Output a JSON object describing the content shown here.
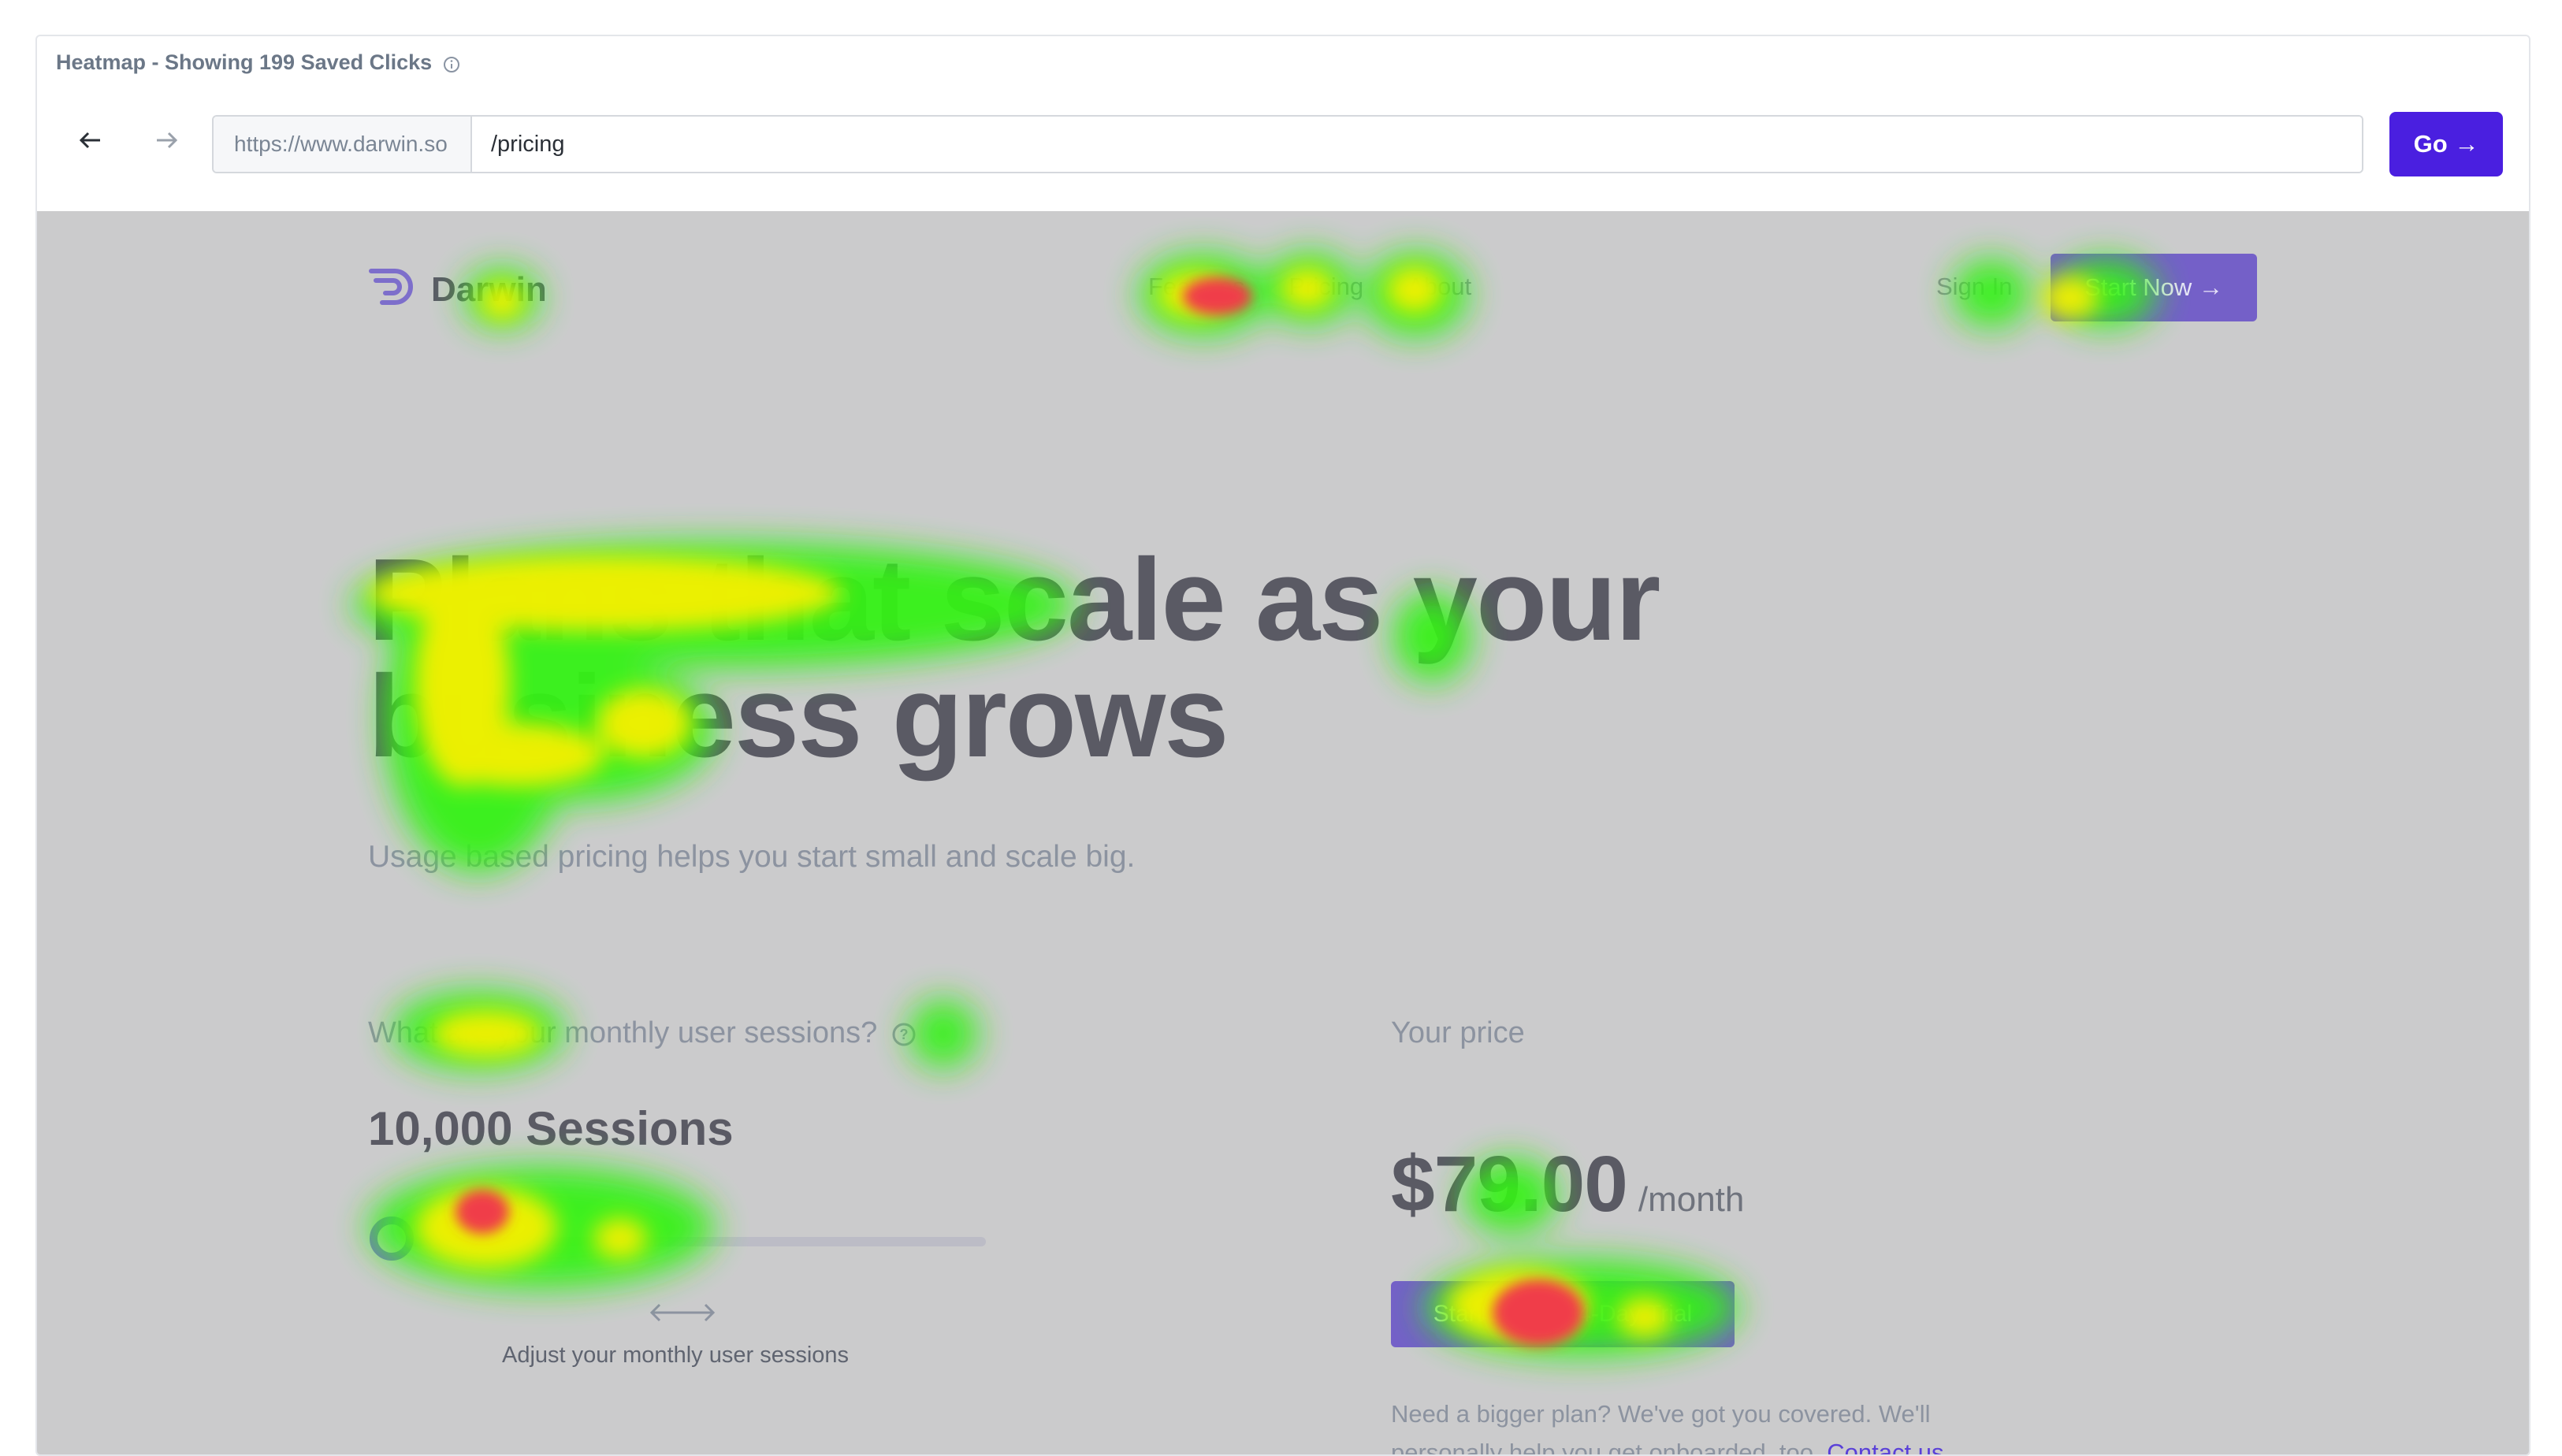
{
  "panel": {
    "title": "Heatmap - Showing 199 Saved Clicks",
    "info_icon": "info-circle-icon"
  },
  "toolbar": {
    "back_icon": "arrow-left-icon",
    "forward_icon": "arrow-right-icon",
    "url_prefix": "https://www.darwin.so",
    "url_path": "/pricing",
    "go_label": "Go →"
  },
  "site": {
    "logo_text": "Darwin",
    "nav": [
      "Features",
      "Pricing",
      "About"
    ],
    "sign_in": "Sign In",
    "start_now": "Start Now →",
    "hero_line1": "Plans that scale as your",
    "hero_line2": "business grows",
    "hero_sub": "Usage based pricing helps you start small and scale big.",
    "sessions_question": "What are your monthly user sessions?",
    "sessions_value": "10,000 Sessions",
    "slider_level": 0.02,
    "slider_hint": "Adjust your monthly user sessions",
    "price_label": "Your price",
    "price_amount": "$79.00",
    "price_period": "/month",
    "trial_button": "Start a Free 14-Day Trial",
    "bigger_plan_text": "Need a bigger plan? We've got you covered. We'll personally help you get onboarded, too.",
    "contact_link": "Contact us"
  },
  "colors": {
    "go_button": "#4a1fe0",
    "overlay": "#cbcbcc",
    "accent_purple": "#7460c8",
    "heat_green": "#34f213",
    "heat_yellow": "#f5f000",
    "heat_red": "#f03c4a"
  }
}
